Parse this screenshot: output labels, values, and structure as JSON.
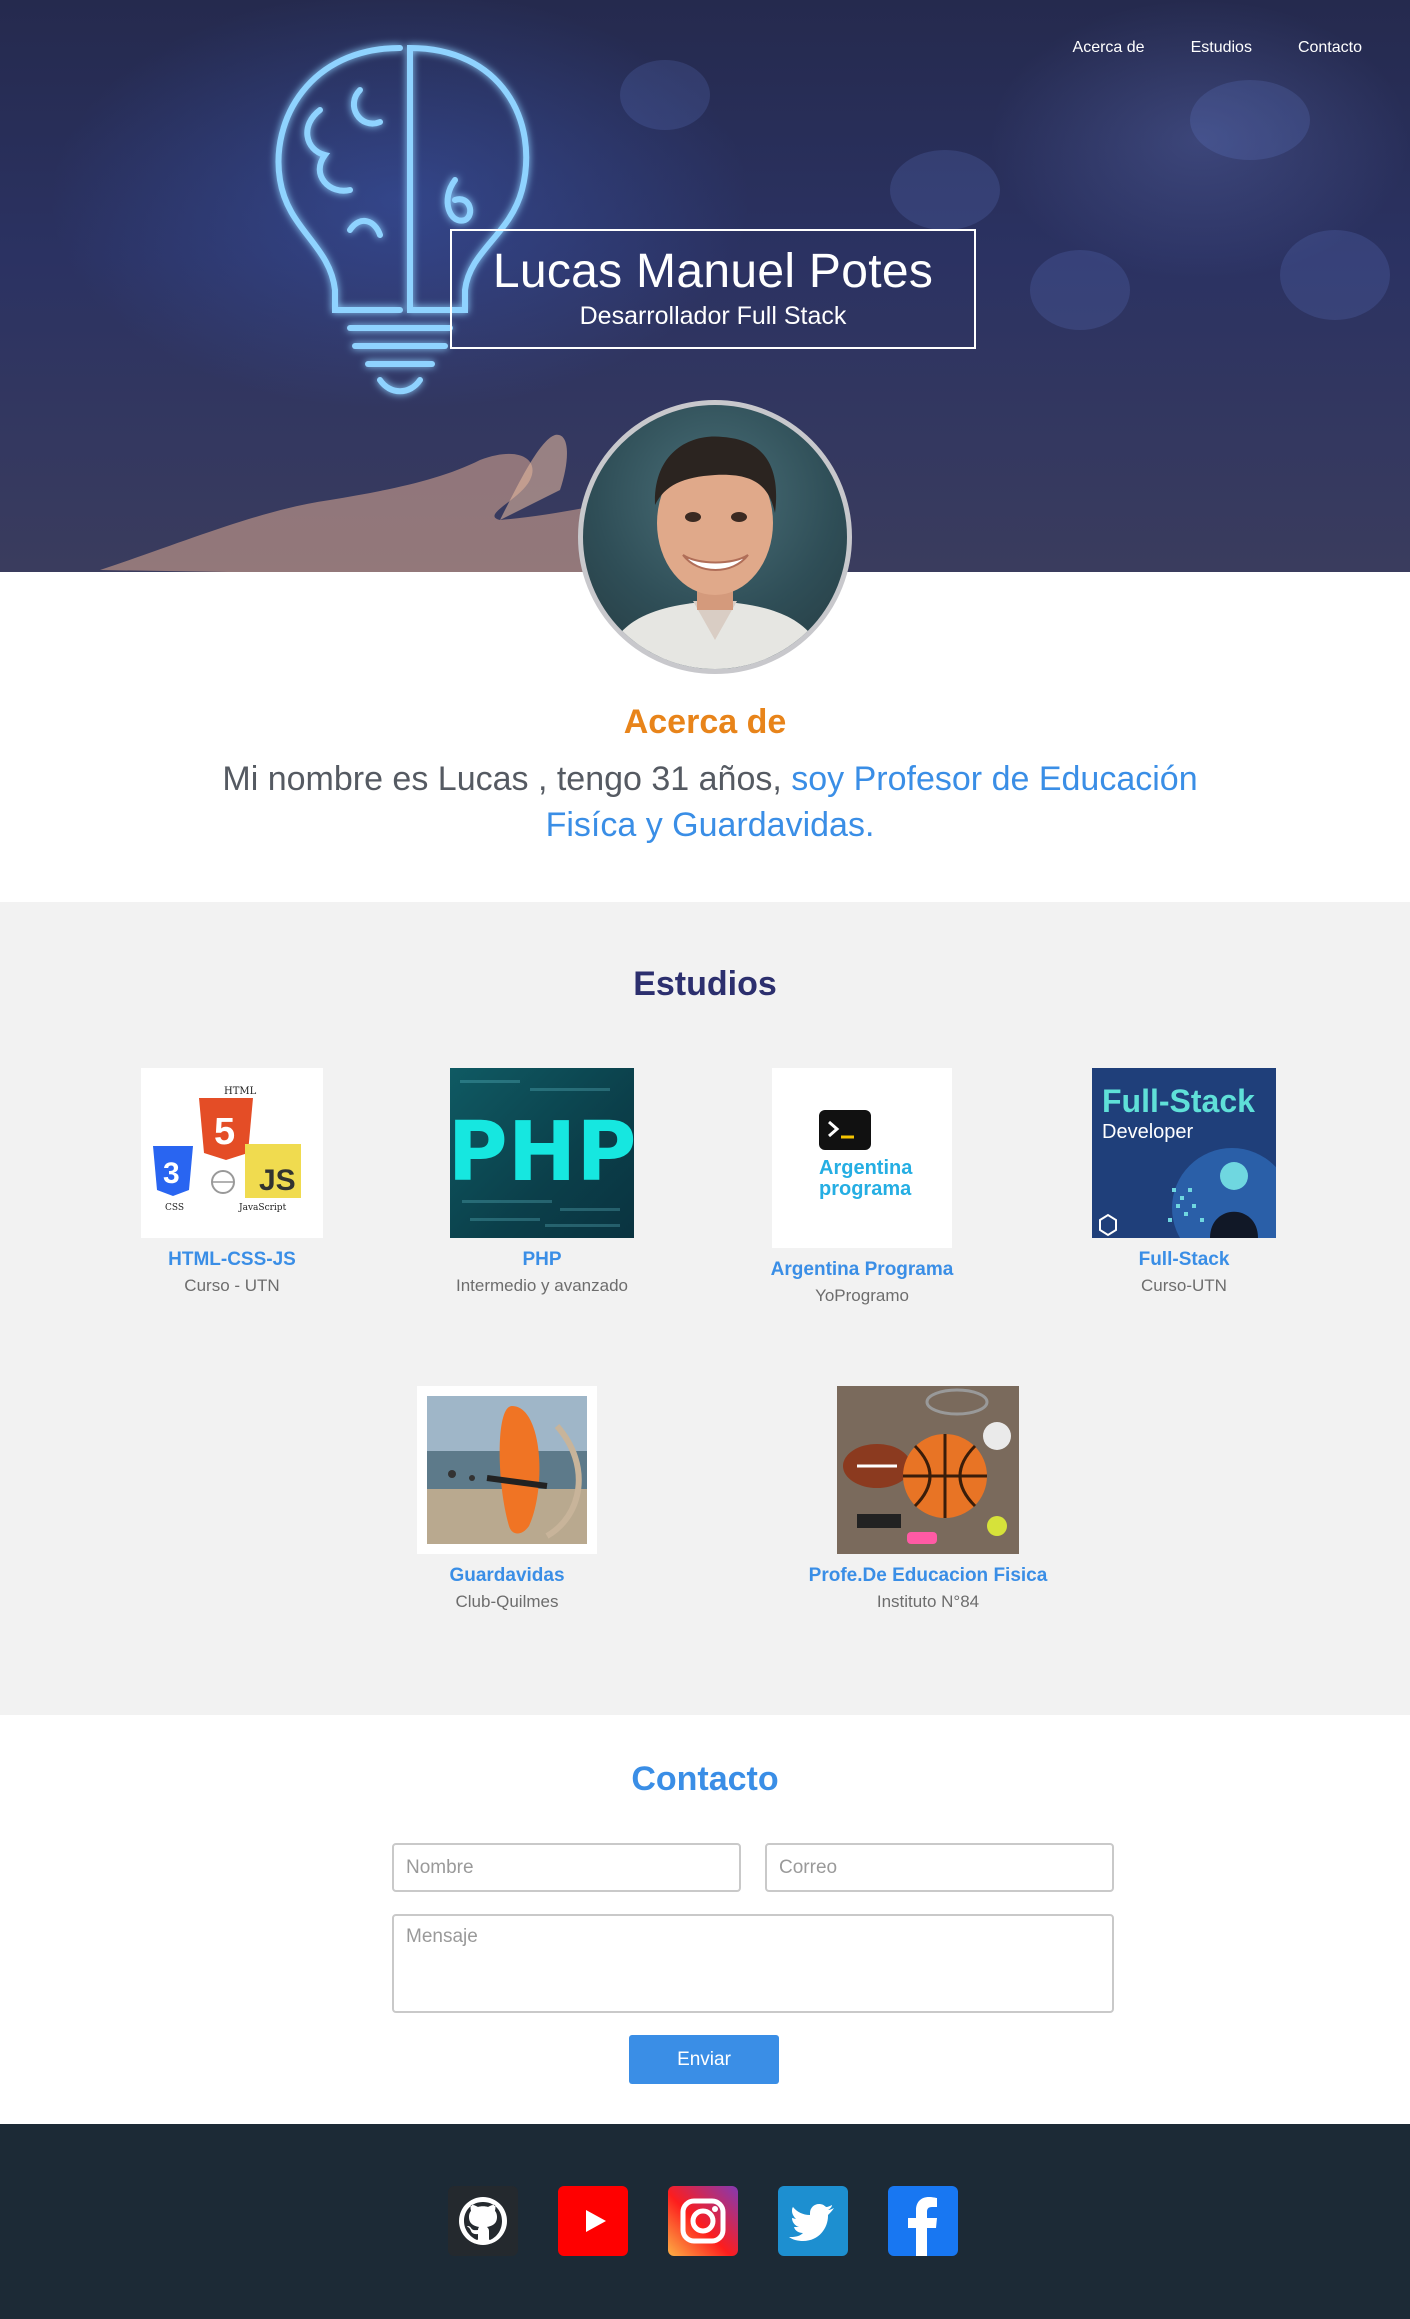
{
  "nav": {
    "items": [
      "Acerca de",
      "Estudios",
      "Contacto"
    ]
  },
  "hero": {
    "name": "Lucas Manuel Potes",
    "role": "Desarrollador Full Stack"
  },
  "about": {
    "title": "Acerca de",
    "text_plain": "Mi nombre es Lucas , tengo 31 años, ",
    "text_highlight": "soy Profesor de Educación Fisíca y Guardavidas."
  },
  "studies": {
    "title": "Estudios",
    "items": [
      {
        "title": "HTML-CSS-JS",
        "subtitle": "Curso - UTN",
        "icon": "html-css-js-logo"
      },
      {
        "title": "PHP",
        "subtitle": "Intermedio y avanzado",
        "icon": "php-logo"
      },
      {
        "title": "Argentina Programa",
        "subtitle": "YoProgramo",
        "icon": "argentina-programa-logo"
      },
      {
        "title": "Full-Stack",
        "subtitle": "Curso-UTN",
        "icon": "full-stack-developer-logo"
      },
      {
        "title": "Guardavidas",
        "subtitle": "Club-Quilmes",
        "icon": "lifeguard-photo"
      },
      {
        "title": "Profe.De Educacion Fisica",
        "subtitle": "Instituto N°84",
        "icon": "sports-equipment-photo"
      }
    ],
    "logo_text": {
      "html": "HTML",
      "html_digit": "5",
      "css_digit": "3",
      "css": "CSS",
      "js": "JS",
      "javascript": "JavaScript",
      "php": "PHP",
      "arg_line1": "Argentina",
      "arg_line2": "programa",
      "fs_line1": "Full-Stack",
      "fs_line2": "Developer"
    }
  },
  "contact": {
    "title": "Contacto",
    "name_placeholder": "Nombre",
    "email_placeholder": "Correo",
    "message_placeholder": "Mensaje",
    "send_label": "Enviar"
  },
  "footer": {
    "social": [
      "github-icon",
      "youtube-icon",
      "instagram-icon",
      "twitter-icon",
      "facebook-icon"
    ]
  },
  "colors": {
    "accent_blue": "#3a8ee6",
    "about_orange": "#e8841a",
    "studies_title": "#2c2f6e",
    "footer_bg": "#1c2a36",
    "studies_bg": "#f2f2f2"
  }
}
